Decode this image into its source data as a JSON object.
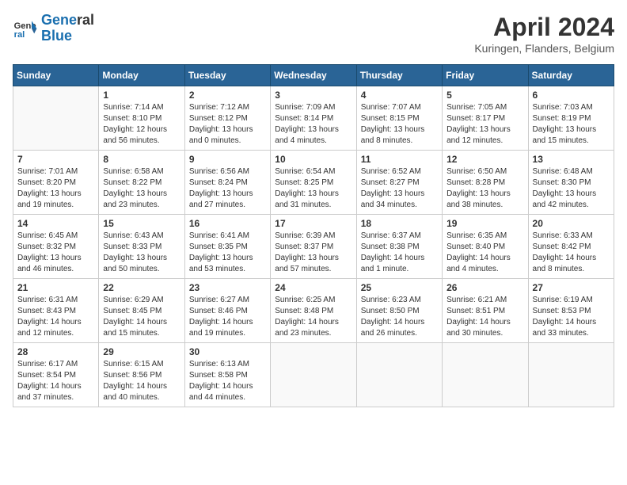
{
  "header": {
    "logo_line1": "General",
    "logo_line2": "Blue",
    "title": "April 2024",
    "location": "Kuringen, Flanders, Belgium"
  },
  "calendar": {
    "days_of_week": [
      "Sunday",
      "Monday",
      "Tuesday",
      "Wednesday",
      "Thursday",
      "Friday",
      "Saturday"
    ],
    "weeks": [
      [
        {
          "day": "",
          "empty": true
        },
        {
          "day": "1",
          "sunrise": "Sunrise: 7:14 AM",
          "sunset": "Sunset: 8:10 PM",
          "daylight": "Daylight: 12 hours and 56 minutes."
        },
        {
          "day": "2",
          "sunrise": "Sunrise: 7:12 AM",
          "sunset": "Sunset: 8:12 PM",
          "daylight": "Daylight: 13 hours and 0 minutes."
        },
        {
          "day": "3",
          "sunrise": "Sunrise: 7:09 AM",
          "sunset": "Sunset: 8:14 PM",
          "daylight": "Daylight: 13 hours and 4 minutes."
        },
        {
          "day": "4",
          "sunrise": "Sunrise: 7:07 AM",
          "sunset": "Sunset: 8:15 PM",
          "daylight": "Daylight: 13 hours and 8 minutes."
        },
        {
          "day": "5",
          "sunrise": "Sunrise: 7:05 AM",
          "sunset": "Sunset: 8:17 PM",
          "daylight": "Daylight: 13 hours and 12 minutes."
        },
        {
          "day": "6",
          "sunrise": "Sunrise: 7:03 AM",
          "sunset": "Sunset: 8:19 PM",
          "daylight": "Daylight: 13 hours and 15 minutes."
        }
      ],
      [
        {
          "day": "7",
          "sunrise": "Sunrise: 7:01 AM",
          "sunset": "Sunset: 8:20 PM",
          "daylight": "Daylight: 13 hours and 19 minutes."
        },
        {
          "day": "8",
          "sunrise": "Sunrise: 6:58 AM",
          "sunset": "Sunset: 8:22 PM",
          "daylight": "Daylight: 13 hours and 23 minutes."
        },
        {
          "day": "9",
          "sunrise": "Sunrise: 6:56 AM",
          "sunset": "Sunset: 8:24 PM",
          "daylight": "Daylight: 13 hours and 27 minutes."
        },
        {
          "day": "10",
          "sunrise": "Sunrise: 6:54 AM",
          "sunset": "Sunset: 8:25 PM",
          "daylight": "Daylight: 13 hours and 31 minutes."
        },
        {
          "day": "11",
          "sunrise": "Sunrise: 6:52 AM",
          "sunset": "Sunset: 8:27 PM",
          "daylight": "Daylight: 13 hours and 34 minutes."
        },
        {
          "day": "12",
          "sunrise": "Sunrise: 6:50 AM",
          "sunset": "Sunset: 8:28 PM",
          "daylight": "Daylight: 13 hours and 38 minutes."
        },
        {
          "day": "13",
          "sunrise": "Sunrise: 6:48 AM",
          "sunset": "Sunset: 8:30 PM",
          "daylight": "Daylight: 13 hours and 42 minutes."
        }
      ],
      [
        {
          "day": "14",
          "sunrise": "Sunrise: 6:45 AM",
          "sunset": "Sunset: 8:32 PM",
          "daylight": "Daylight: 13 hours and 46 minutes."
        },
        {
          "day": "15",
          "sunrise": "Sunrise: 6:43 AM",
          "sunset": "Sunset: 8:33 PM",
          "daylight": "Daylight: 13 hours and 50 minutes."
        },
        {
          "day": "16",
          "sunrise": "Sunrise: 6:41 AM",
          "sunset": "Sunset: 8:35 PM",
          "daylight": "Daylight: 13 hours and 53 minutes."
        },
        {
          "day": "17",
          "sunrise": "Sunrise: 6:39 AM",
          "sunset": "Sunset: 8:37 PM",
          "daylight": "Daylight: 13 hours and 57 minutes."
        },
        {
          "day": "18",
          "sunrise": "Sunrise: 6:37 AM",
          "sunset": "Sunset: 8:38 PM",
          "daylight": "Daylight: 14 hours and 1 minute."
        },
        {
          "day": "19",
          "sunrise": "Sunrise: 6:35 AM",
          "sunset": "Sunset: 8:40 PM",
          "daylight": "Daylight: 14 hours and 4 minutes."
        },
        {
          "day": "20",
          "sunrise": "Sunrise: 6:33 AM",
          "sunset": "Sunset: 8:42 PM",
          "daylight": "Daylight: 14 hours and 8 minutes."
        }
      ],
      [
        {
          "day": "21",
          "sunrise": "Sunrise: 6:31 AM",
          "sunset": "Sunset: 8:43 PM",
          "daylight": "Daylight: 14 hours and 12 minutes."
        },
        {
          "day": "22",
          "sunrise": "Sunrise: 6:29 AM",
          "sunset": "Sunset: 8:45 PM",
          "daylight": "Daylight: 14 hours and 15 minutes."
        },
        {
          "day": "23",
          "sunrise": "Sunrise: 6:27 AM",
          "sunset": "Sunset: 8:46 PM",
          "daylight": "Daylight: 14 hours and 19 minutes."
        },
        {
          "day": "24",
          "sunrise": "Sunrise: 6:25 AM",
          "sunset": "Sunset: 8:48 PM",
          "daylight": "Daylight: 14 hours and 23 minutes."
        },
        {
          "day": "25",
          "sunrise": "Sunrise: 6:23 AM",
          "sunset": "Sunset: 8:50 PM",
          "daylight": "Daylight: 14 hours and 26 minutes."
        },
        {
          "day": "26",
          "sunrise": "Sunrise: 6:21 AM",
          "sunset": "Sunset: 8:51 PM",
          "daylight": "Daylight: 14 hours and 30 minutes."
        },
        {
          "day": "27",
          "sunrise": "Sunrise: 6:19 AM",
          "sunset": "Sunset: 8:53 PM",
          "daylight": "Daylight: 14 hours and 33 minutes."
        }
      ],
      [
        {
          "day": "28",
          "sunrise": "Sunrise: 6:17 AM",
          "sunset": "Sunset: 8:54 PM",
          "daylight": "Daylight: 14 hours and 37 minutes."
        },
        {
          "day": "29",
          "sunrise": "Sunrise: 6:15 AM",
          "sunset": "Sunset: 8:56 PM",
          "daylight": "Daylight: 14 hours and 40 minutes."
        },
        {
          "day": "30",
          "sunrise": "Sunrise: 6:13 AM",
          "sunset": "Sunset: 8:58 PM",
          "daylight": "Daylight: 14 hours and 44 minutes."
        },
        {
          "day": "",
          "empty": true
        },
        {
          "day": "",
          "empty": true
        },
        {
          "day": "",
          "empty": true
        },
        {
          "day": "",
          "empty": true
        }
      ]
    ]
  }
}
